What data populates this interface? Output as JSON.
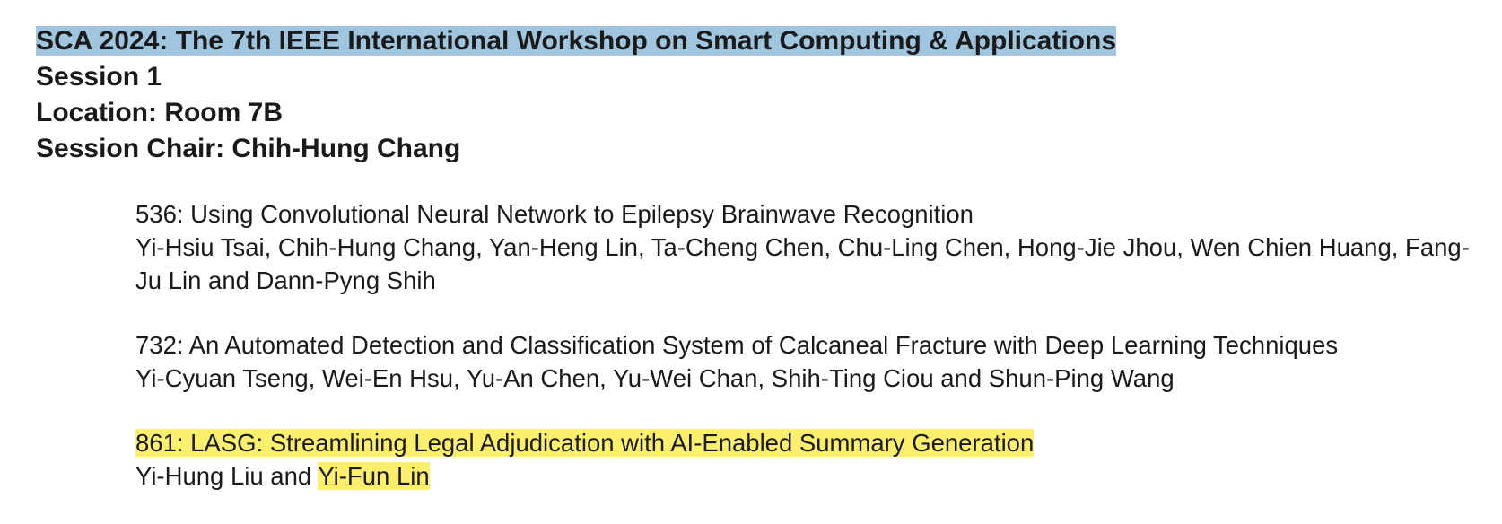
{
  "workshop": {
    "title": "SCA 2024: The 7th IEEE International Workshop on Smart Computing & Applications",
    "session": "Session 1",
    "location": "Location: Room 7B",
    "chair": "Session Chair: Chih-Hung Chang"
  },
  "papers": [
    {
      "title": "536: Using Convolutional Neural Network to Epilepsy Brainwave Recognition",
      "authors": "Yi-Hsiu Tsai, Chih-Hung Chang, Yan-Heng Lin, Ta-Cheng Chen, Chu-Ling Chen, Hong-Jie Jhou, Wen Chien Huang, Fang-Ju Lin and Dann-Pyng Shih"
    },
    {
      "title": "732: An Automated Detection and Classification System of Calcaneal Fracture with Deep Learning Techniques",
      "authors": "Yi-Cyuan Tseng, Wei-En Hsu, Yu-An Chen, Yu-Wei Chan, Shih-Ting Ciou and Shun-Ping Wang"
    },
    {
      "title": "861: LASG: Streamlining Legal Adjudication with AI-Enabled Summary Generation",
      "authors_prefix": "Yi-Hung Liu and ",
      "authors_highlight": "Yi-Fun Lin"
    }
  ],
  "colors": {
    "title_highlight": "#9fc5df",
    "paper_highlight": "#fdef6e"
  }
}
